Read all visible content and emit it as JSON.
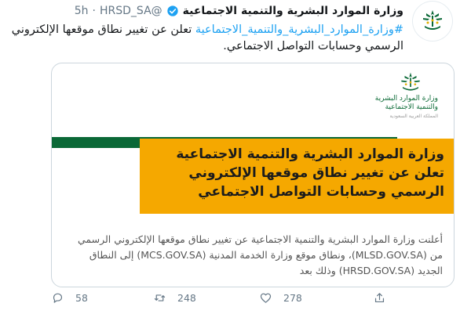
{
  "tweet": {
    "display_name": "وزارة الموارد البشرية والتنمية الاجتماعية",
    "handle": "@HRSD_SA",
    "dot": "·",
    "time": "5h",
    "text_hashtag": "#وزارة_الموارد_البشرية_والتنمية_الاجتماعية",
    "text_rest": " تعلن عن تغيير نطاق موقعها الإلكتروني الرسمي وحسابات التواصل الاجتماعي."
  },
  "media": {
    "logo_line1": "وزارة الموارد البشرية",
    "logo_line2": "والتنمية الاجتماعية",
    "logo_line3": "المملكة العربية السعودية",
    "headline": "وزارة الموارد البشرية والتنمية الاجتماعية تعلن عن تغيير نطاق موقعها الإلكتروني الرسمي وحسابات التواصل الاجتماعي",
    "body": "أعلنت وزارة الموارد البشرية والتنمية الاجتماعية عن تغيير نطاق موقعها الإلكتروني الرسمي من (MLSD.GOV.SA)، ونطاق موقع وزارة الخدمة المدنية (MCS.GOV.SA) إلى النطاق الجديد (HRSD.GOV.SA) وذلك بعد"
  },
  "actions": {
    "replies": "58",
    "retweets": "248",
    "likes": "278"
  },
  "colors": {
    "accent": "#1da1f2",
    "green": "#0a6836",
    "orange": "#f5a800"
  },
  "icons": [
    "verified-badge-icon",
    "reply-icon",
    "retweet-icon",
    "like-icon",
    "share-icon",
    "ministry-logo-icon"
  ]
}
